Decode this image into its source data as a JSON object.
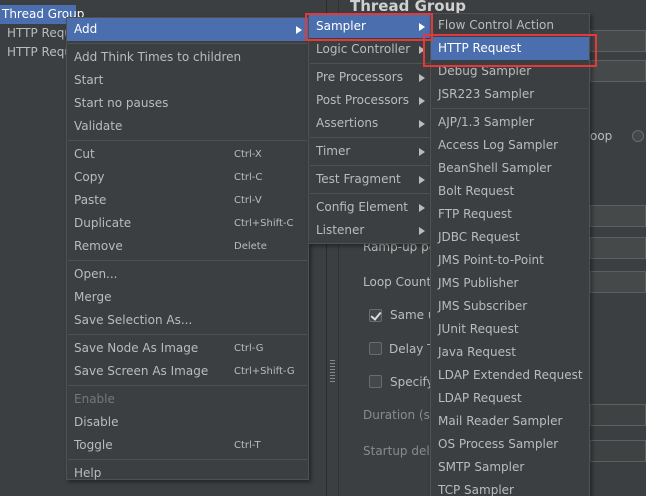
{
  "tree": {
    "items": [
      {
        "label": "Thread Group"
      },
      {
        "label": "HTTP Requ"
      },
      {
        "label": "HTTP Requ"
      }
    ]
  },
  "panel": {
    "title": "Thread Group",
    "labels": {
      "loop_radio": "oop",
      "rampup": "Ramp-up pe",
      "loop_count": "Loop Count:",
      "same_user": "Same u",
      "delay": "Delay T",
      "specify": "Specify",
      "duration": "Duration (se",
      "startup_delay": "Startup dela"
    }
  },
  "context_menu": {
    "items": [
      {
        "label": "Add",
        "submenu": true,
        "active": true
      },
      {
        "separator": true
      },
      {
        "label": "Add Think Times to children"
      },
      {
        "label": "Start"
      },
      {
        "label": "Start no pauses"
      },
      {
        "label": "Validate"
      },
      {
        "separator": true
      },
      {
        "label": "Cut",
        "shortcut": "Ctrl-X"
      },
      {
        "label": "Copy",
        "shortcut": "Ctrl-C"
      },
      {
        "label": "Paste",
        "shortcut": "Ctrl-V"
      },
      {
        "label": "Duplicate",
        "shortcut": "Ctrl+Shift-C"
      },
      {
        "label": "Remove",
        "shortcut": "Delete"
      },
      {
        "separator": true
      },
      {
        "label": "Open..."
      },
      {
        "label": "Merge"
      },
      {
        "label": "Save Selection As..."
      },
      {
        "separator": true
      },
      {
        "label": "Save Node As Image",
        "shortcut": "Ctrl-G"
      },
      {
        "label": "Save Screen As Image",
        "shortcut": "Ctrl+Shift-G"
      },
      {
        "separator": true
      },
      {
        "label": "Enable",
        "disabled": true
      },
      {
        "label": "Disable"
      },
      {
        "label": "Toggle",
        "shortcut": "Ctrl-T"
      },
      {
        "separator": true
      },
      {
        "label": "Help"
      }
    ]
  },
  "add_menu": {
    "items": [
      {
        "label": "Sampler",
        "submenu": true,
        "active": true
      },
      {
        "label": "Logic Controller",
        "submenu": true
      },
      {
        "separator": true
      },
      {
        "label": "Pre Processors",
        "submenu": true
      },
      {
        "label": "Post Processors",
        "submenu": true
      },
      {
        "label": "Assertions",
        "submenu": true
      },
      {
        "separator": true
      },
      {
        "label": "Timer",
        "submenu": true
      },
      {
        "separator": true
      },
      {
        "label": "Test Fragment",
        "submenu": true
      },
      {
        "separator": true
      },
      {
        "label": "Config Element",
        "submenu": true
      },
      {
        "label": "Listener",
        "submenu": true
      }
    ]
  },
  "sampler_menu": {
    "items": [
      {
        "label": "Flow Control Action"
      },
      {
        "label": "HTTP Request",
        "active": true
      },
      {
        "label": "Debug Sampler"
      },
      {
        "label": "JSR223 Sampler"
      },
      {
        "separator": true
      },
      {
        "label": "AJP/1.3 Sampler"
      },
      {
        "label": "Access Log Sampler"
      },
      {
        "label": "BeanShell Sampler"
      },
      {
        "label": "Bolt Request"
      },
      {
        "label": "FTP Request"
      },
      {
        "label": "JDBC Request"
      },
      {
        "label": "JMS Point-to-Point"
      },
      {
        "label": "JMS Publisher"
      },
      {
        "label": "JMS Subscriber"
      },
      {
        "label": "JUnit Request"
      },
      {
        "label": "Java Request"
      },
      {
        "label": "LDAP Extended Request"
      },
      {
        "label": "LDAP Request"
      },
      {
        "label": "Mail Reader Sampler"
      },
      {
        "label": "OS Process Sampler"
      },
      {
        "label": "SMTP Sampler"
      },
      {
        "label": "TCP Sampler"
      }
    ]
  },
  "colors": {
    "background": "#3c3f41",
    "selection": "#4b6eaf",
    "text": "#bbbbbb",
    "highlight_annotation": "#e23a3a"
  }
}
